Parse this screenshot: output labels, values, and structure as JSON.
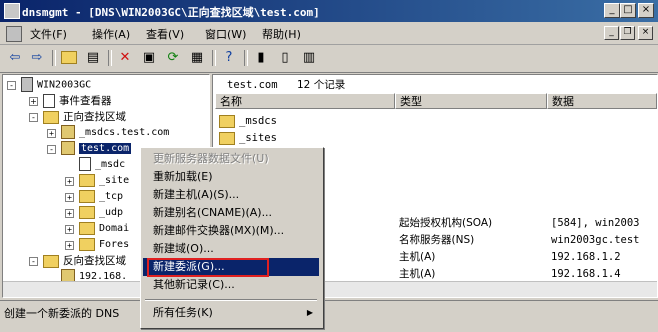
{
  "window": {
    "title": "dnsmgmt - [DNS\\WIN2003GC\\正向查找区域\\test.com]"
  },
  "menubar": [
    "文件(F)",
    "操作(A)",
    "查看(V)",
    "窗口(W)",
    "帮助(H)"
  ],
  "caption_buttons": {
    "minimize": "_",
    "maximize": "□",
    "close": "×"
  },
  "mdi_buttons": {
    "minimize": "_",
    "restore": "❐",
    "close": "×"
  },
  "toolbar_icons": [
    "back-arrow",
    "forward-arrow",
    "up-folder",
    "show-tree",
    "delete-x",
    "properties",
    "refresh",
    "export-list",
    "help",
    "server",
    "new-record",
    "new-zone"
  ],
  "tree": {
    "server": "WIN2003GC",
    "event_viewer": "事件查看器",
    "forward_zones": "正向查找区域",
    "msdcs_zone": "_msdcs.test.com",
    "test_zone": "test.com",
    "children": [
      "_msdc",
      "_site",
      "_tcp",
      "_udp",
      "Domai",
      "Fores"
    ],
    "reverse_zones": "反向查找区域",
    "reverse_child": "192.168."
  },
  "list": {
    "header_zone": "test.com",
    "header_count": "12 个记录",
    "columns": [
      "名称",
      "类型",
      "数据"
    ],
    "folders": [
      "_msdcs",
      "_sites"
    ],
    "rows": [
      {
        "name": ")",
        "type": "起始授权机构(SOA)",
        "data": "[584], win2003"
      },
      {
        "name": ")",
        "type": "名称服务器(NS)",
        "data": "win2003gc.test"
      },
      {
        "name": ")",
        "type": "主机(A)",
        "data": "192.168.1.2"
      },
      {
        "name": ")",
        "type": "主机(A)",
        "data": "192.168.1.4"
      }
    ]
  },
  "context_menu": {
    "items": [
      {
        "label": "更新服务器数据文件(U)",
        "disabled": true
      },
      {
        "label": "重新加载(E)"
      },
      {
        "label": "新建主机(A)(S)..."
      },
      {
        "label": "新建别名(CNAME)(A)..."
      },
      {
        "label": "新建邮件交换器(MX)(M)..."
      },
      {
        "label": "新建域(O)..."
      },
      {
        "label": "新建委派(G)...",
        "highlighted": true
      },
      {
        "label": "其他新记录(C)..."
      },
      {
        "label": "所有任务(K)",
        "submenu": true
      }
    ],
    "submenu_arrow": "▶"
  },
  "statusbar": {
    "text": "创建一个新委派的 DNS"
  },
  "colors": {
    "titlebar": "#0a246a",
    "highlight": "#0a246a",
    "annotation_box": "#e02020",
    "face": "#d4d0c8"
  }
}
